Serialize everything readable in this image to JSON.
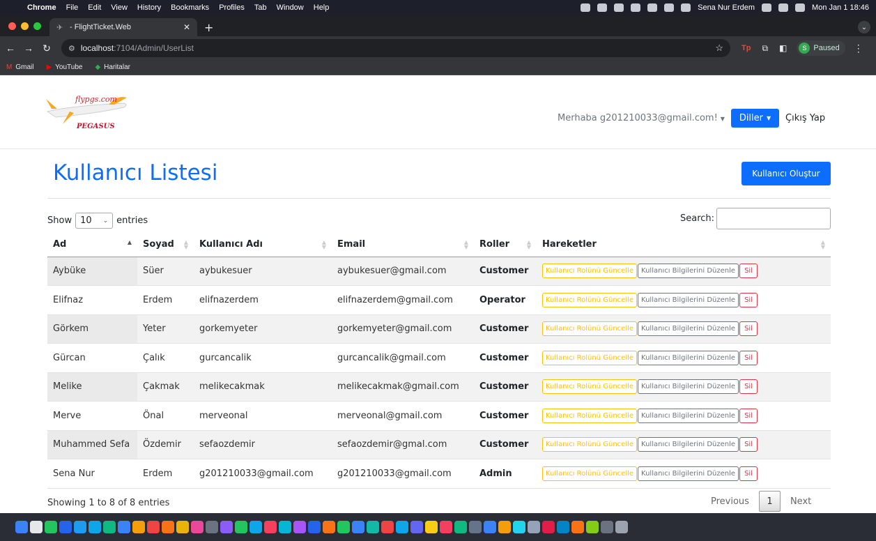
{
  "menubar": {
    "items": [
      "Chrome",
      "File",
      "Edit",
      "View",
      "History",
      "Bookmarks",
      "Profiles",
      "Tab",
      "Window",
      "Help"
    ],
    "user": "Sena Nur Erdem",
    "clock": "Mon Jan 1  18:46"
  },
  "browser": {
    "tab_title": "- FlightTicket.Web",
    "url_host": "localhost",
    "url_path": ":7104/Admin/UserList",
    "profile_status": "Paused",
    "profile_initial": "S",
    "bookmarks": [
      "Gmail",
      "YouTube",
      "Haritalar"
    ]
  },
  "navbar": {
    "greeting": "Merhaba g201210033@gmail.com!",
    "languages_label": "Diller",
    "logout_label": "Çıkış Yap",
    "logo_text_top": "flypgs.com",
    "logo_text_bottom": "PEGASUS"
  },
  "page": {
    "title": "Kullanıcı Listesi",
    "create_button": "Kullanıcı Oluştur",
    "show_label": "Show",
    "entries_value": "10",
    "entries_label": "entries",
    "search_label": "Search:",
    "info": "Showing 1 to 8 of 8 entries",
    "pager": {
      "previous": "Previous",
      "current": "1",
      "next": "Next"
    }
  },
  "table": {
    "headers": [
      "Ad",
      "Soyad",
      "Kullanıcı Adı",
      "Email",
      "Roller",
      "Hareketler"
    ],
    "action_labels": {
      "update_role": "Kullanıcı Rolünü Güncelle",
      "edit_info": "Kullanıcı Bilgilerini Düzenle",
      "delete": "Sil"
    },
    "rows": [
      {
        "ad": "Aybüke",
        "soyad": "Süer",
        "username": "aybukesuer",
        "email": "aybukesuer@gmail.com",
        "role": "Customer"
      },
      {
        "ad": "Elifnaz",
        "soyad": "Erdem",
        "username": "elifnazerdem",
        "email": "elifnazerdem@gmail.com",
        "role": "Operator"
      },
      {
        "ad": "Görkem",
        "soyad": "Yeter",
        "username": "gorkemyeter",
        "email": "gorkemyeter@gmail.com",
        "role": "Customer"
      },
      {
        "ad": "Gürcan",
        "soyad": "Çalık",
        "username": "gurcancalik",
        "email": "gurcancalik@gmail.com",
        "role": "Customer"
      },
      {
        "ad": "Melike",
        "soyad": "Çakmak",
        "username": "melikecakmak",
        "email": "melikecakmak@gmail.com",
        "role": "Customer"
      },
      {
        "ad": "Merve",
        "soyad": "Önal",
        "username": "merveonal",
        "email": "merveonal@gmail.com",
        "role": "Customer"
      },
      {
        "ad": "Muhammed Sefa",
        "soyad": "Özdemir",
        "username": "sefaozdemir",
        "email": "sefaozdemir@gmal.com",
        "role": "Customer"
      },
      {
        "ad": "Sena Nur",
        "soyad": "Erdem",
        "username": "g201210033@gmail.com",
        "email": "g201210033@gmail.com",
        "role": "Admin"
      }
    ]
  },
  "colors": {
    "primary": "#0d6efd",
    "warning": "#ffc107",
    "secondary": "#6c757d",
    "danger": "#dc3545"
  }
}
